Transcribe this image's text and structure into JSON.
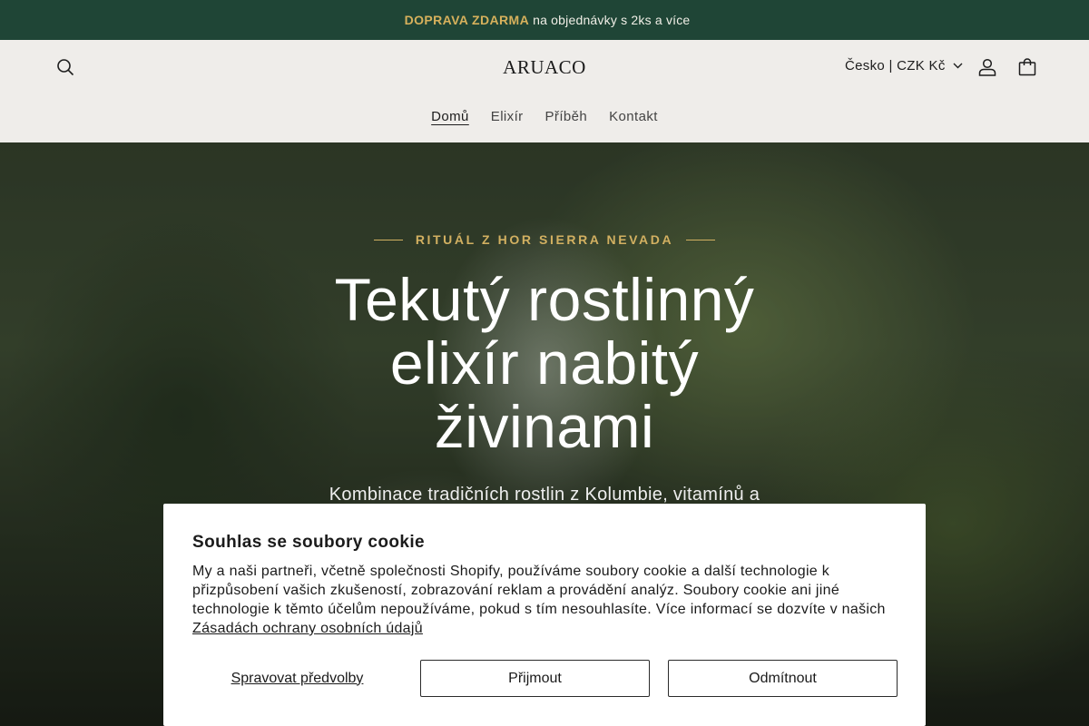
{
  "announcement": {
    "icon": "truck-icon",
    "glyph": "",
    "highlight": "DOPRAVA ZDARMA",
    "text": "na objednávky s 2ks a více",
    "highlight_color": "#d7b15c",
    "background": "#1f4536"
  },
  "header": {
    "logo": "ARUACO",
    "locale": "Česko | CZK Kč",
    "icons": [
      "search-icon",
      "chevron-down-icon",
      "account-icon",
      "cart-icon"
    ]
  },
  "nav": {
    "items": [
      {
        "label": "Domů",
        "active": true
      },
      {
        "label": "Elixír",
        "active": false
      },
      {
        "label": "Příběh",
        "active": false
      },
      {
        "label": "Kontakt",
        "active": false
      }
    ]
  },
  "hero": {
    "eyebrow": "RITUÁL Z HOR SIERRA NEVADA",
    "headline_lines": [
      "Tekutý rostlinný",
      "elixír nabitý",
      "živinami"
    ],
    "subline": "Kombinace tradičních rostlin z Kolumbie, vitamínů a",
    "accent_color": "#d2b061"
  },
  "cookie": {
    "title": "Souhlas se soubory cookie",
    "body": "My a naši partneři, včetně společnosti Shopify, používáme soubory cookie a další technologie k přizpůsobení vašich zkušeností, zobrazování reklam a provádění analýz. Soubory cookie ani jiné technologie k těmto účelům nepoužíváme, pokud s tím nesouhlasíte. Více informací se dozvíte v našich",
    "policy_link": "Zásadách ochrany osobních údajů",
    "manage_label": "Spravovat předvolby",
    "accept_label": "Přijmout",
    "decline_label": "Odmítnout"
  }
}
